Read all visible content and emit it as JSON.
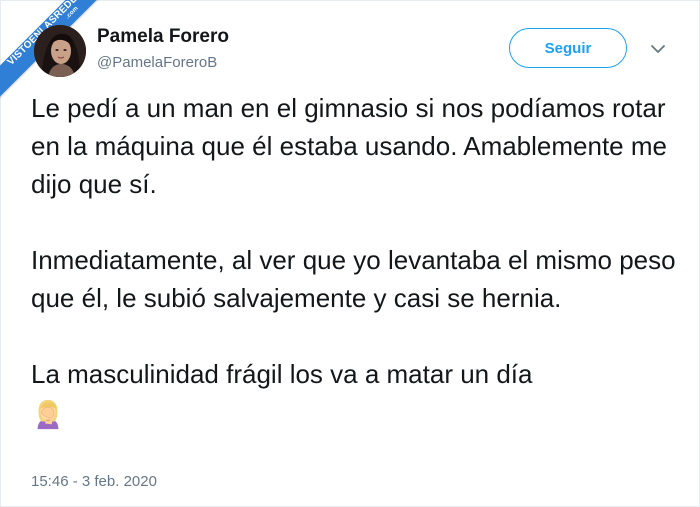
{
  "watermark": {
    "main": "VISTOENLASREDES",
    "sub": ".com"
  },
  "tweet": {
    "author_name": "Pamela Forero",
    "author_handle": "@PamelaForeroB",
    "follow_label": "Seguir",
    "paragraphs": [
      "Le pedí a un man en el gimnasio si nos podíamos rotar en la máquina que él estaba usando. Amablemente me dijo que sí.",
      "Inmediatamente, al ver que yo levantaba el mismo peso que él, le subió salvajemente y casi se hernia.",
      "La masculinidad frágil los va a matar un día"
    ],
    "emoji": "woman-facepalming-emoji",
    "timestamp": "15:46 - 3 feb. 2020"
  },
  "colors": {
    "accent": "#1da1f2",
    "text": "#14171a",
    "secondary_text": "#657786",
    "ribbon": "#2f7fd6"
  }
}
